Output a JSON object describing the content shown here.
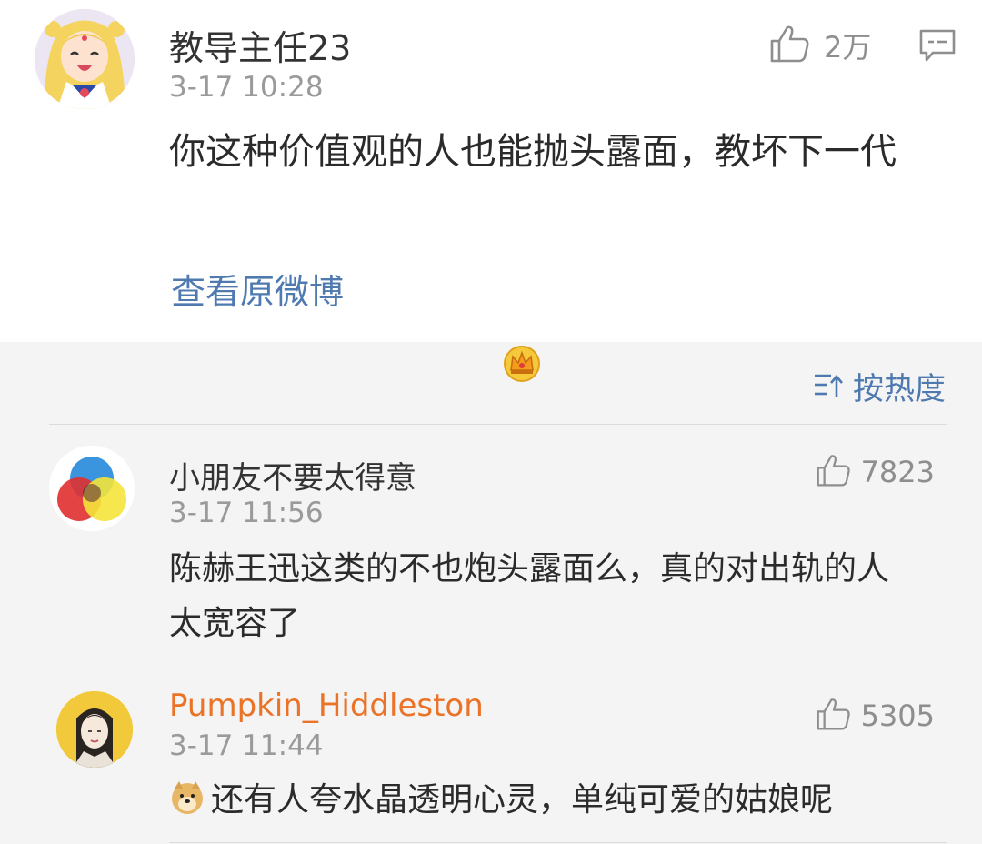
{
  "post": {
    "author": "教导主任23",
    "time": "3-17 10:28",
    "text": "你这种价值观的人也能抛头露面，教坏下一代",
    "likes": "2万",
    "view_original": "查看原微博",
    "avatar_icon": "sailor-moon-avatar",
    "like_icon": "thumbs-up-icon",
    "comment_icon": "comment-icon"
  },
  "comments_section": {
    "sort_label": "按热度",
    "sort_icon": "sort-icon",
    "link_color": "#4f7ab0",
    "vip_name_color": "#eb7327"
  },
  "comments": [
    {
      "author": "小朋友不要太得意",
      "time": "3-17 11:56",
      "text": "陈赫王迅这类的不也炮头露面么，真的对出轨的人太宽容了",
      "likes": "7823",
      "avatar_icon": "color-circles-avatar"
    },
    {
      "author": "Pumpkin_Hiddleston",
      "time": "3-17 11:44",
      "text": "还有人夸水晶透明心灵，单纯可爱的姑娘呢",
      "likes": "5305",
      "avatar_icon": "anime-character-avatar",
      "badge_icon": "crown-icon",
      "emoji_icon": "doge-emoji-icon"
    }
  ]
}
